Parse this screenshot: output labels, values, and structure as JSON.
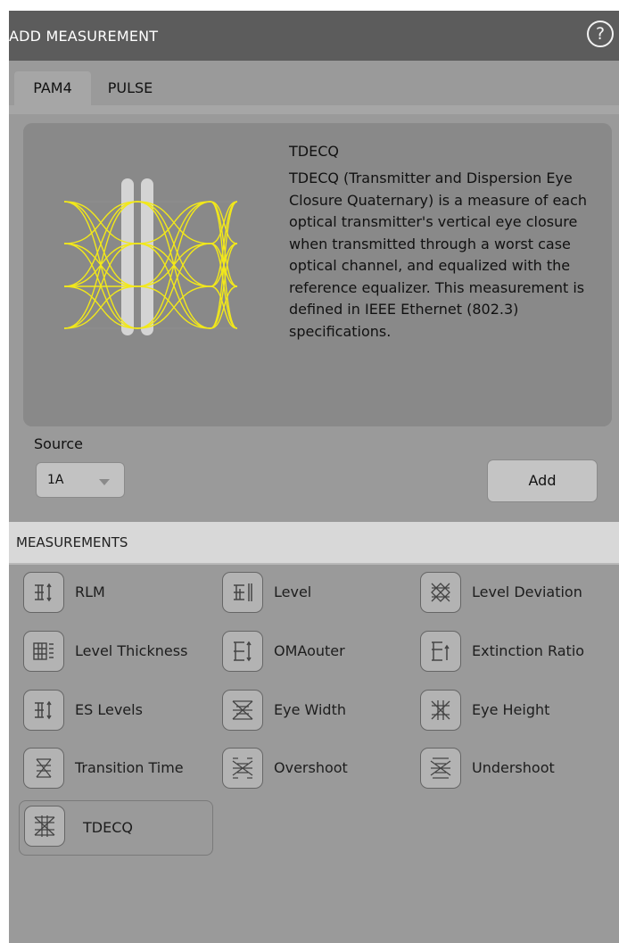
{
  "header": {
    "title": "ADD MEASUREMENT",
    "help_icon": "help-circle-icon",
    "help_glyph": "?"
  },
  "tabs": [
    {
      "label": "PAM4",
      "active": true
    },
    {
      "label": "PULSE",
      "active": false
    }
  ],
  "info": {
    "title": "TDECQ",
    "description": "TDECQ (Transmitter and Dispersion Eye Closure Quaternary) is a measure of each optical transmitter's vertical eye closure when transmitted through a worst case optical channel, and equalized with the reference equalizer. This measurement is defined in IEEE Ethernet (802.3) specifications.",
    "image": "pam4-eye-diagram-icon",
    "eye_color": "#f2e81a"
  },
  "source": {
    "label": "Source",
    "value": "1A"
  },
  "add_button": {
    "label": "Add"
  },
  "measurements": {
    "header": "MEASUREMENTS",
    "selected": "TDECQ",
    "items": [
      {
        "label": "RLM",
        "icon": "rlm-icon"
      },
      {
        "label": "Level",
        "icon": "level-icon"
      },
      {
        "label": "Level Deviation",
        "icon": "level-deviation-icon"
      },
      {
        "label": "Level Thickness",
        "icon": "level-thickness-icon"
      },
      {
        "label": "OMAouter",
        "icon": "omaouter-icon"
      },
      {
        "label": "Extinction Ratio",
        "icon": "extinction-ratio-icon"
      },
      {
        "label": "ES Levels",
        "icon": "es-levels-icon"
      },
      {
        "label": "Eye Width",
        "icon": "eye-width-icon"
      },
      {
        "label": "Eye Height",
        "icon": "eye-height-icon"
      },
      {
        "label": "Transition Time",
        "icon": "transition-time-icon"
      },
      {
        "label": "Overshoot",
        "icon": "overshoot-icon"
      },
      {
        "label": "Undershoot",
        "icon": "undershoot-icon"
      },
      {
        "label": "TDECQ",
        "icon": "tdecq-icon"
      }
    ]
  }
}
